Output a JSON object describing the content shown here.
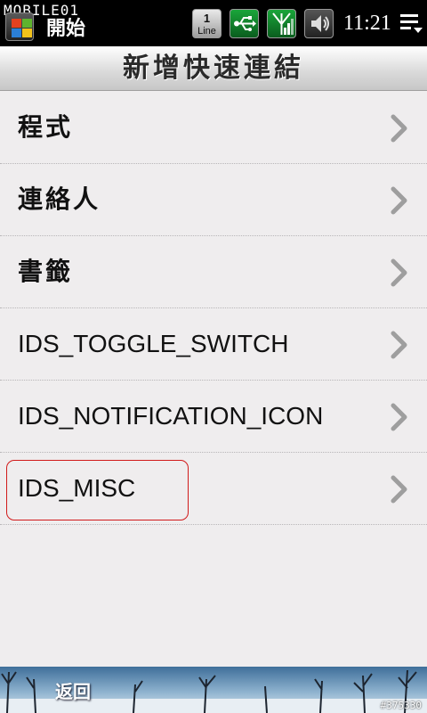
{
  "status_bar": {
    "watermark": "MOBILE01",
    "start_label": "開始",
    "line_number": "1",
    "line_text": "Line",
    "time": "11:21"
  },
  "title": "新增快速連結",
  "items": [
    {
      "label": "程式"
    },
    {
      "label": "連絡人"
    },
    {
      "label": "書籤"
    },
    {
      "label": "IDS_TOGGLE_SWITCH"
    },
    {
      "label": "IDS_NOTIFICATION_ICON"
    },
    {
      "label": "IDS_MISC"
    }
  ],
  "bottom": {
    "back_label": "返回",
    "photo_id": "#375330"
  },
  "colors": {
    "background": "#efedee",
    "status_bar": "#000000",
    "selection_outline": "#d11a1a",
    "chevron": "#9e9e9e"
  }
}
